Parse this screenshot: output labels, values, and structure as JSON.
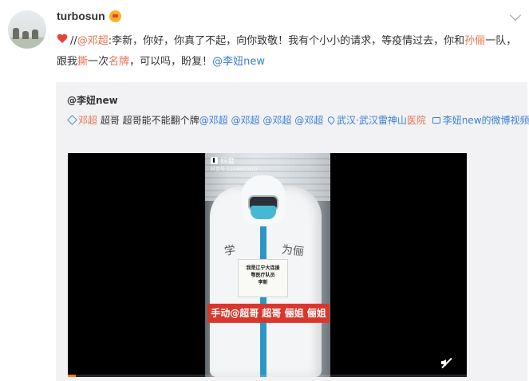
{
  "post": {
    "username": "turbosun",
    "text": {
      "prefix": "//",
      "mention_1": "@邓超",
      "part_1": ":李新，你好，你真了不起，向你致敬！我有个小小的请求，等疫情过去，你和",
      "name_1": "孙俪",
      "part_2": "一队，跟我",
      "word_1": "撕",
      "part_3": "一次",
      "word_2": "名牌",
      "part_4": "，可以吗，盼复！",
      "mention_2": "@李妞new"
    }
  },
  "repost": {
    "username": "@李妞new",
    "text": {
      "tag_1": "邓超",
      "plain_1": " 超哥 超哥能不能翻个牌",
      "mentions": [
        "@邓超",
        "@邓超",
        "@邓超",
        "@邓超"
      ],
      "location_prefix": "武汉·武汉雷神山",
      "location_hl": "医院",
      "video_link": "李妞new的微博视频"
    },
    "video": {
      "app_name": "抖音",
      "app_id": "抖音号:1104683910",
      "paper_line_1": "我是辽宁大连援",
      "paper_line_2": "鄂医疗队员",
      "paper_line_3": "李新",
      "back_text_1": "学",
      "back_text_2": "为俪",
      "caption": "手动@超哥 超哥 俪姐 俪姐",
      "progress": 0.02,
      "progress_color": "#ff8200"
    }
  },
  "icons": {
    "crown": "vip-crown-icon",
    "heart": "heart-icon",
    "mute": "mute-icon"
  }
}
